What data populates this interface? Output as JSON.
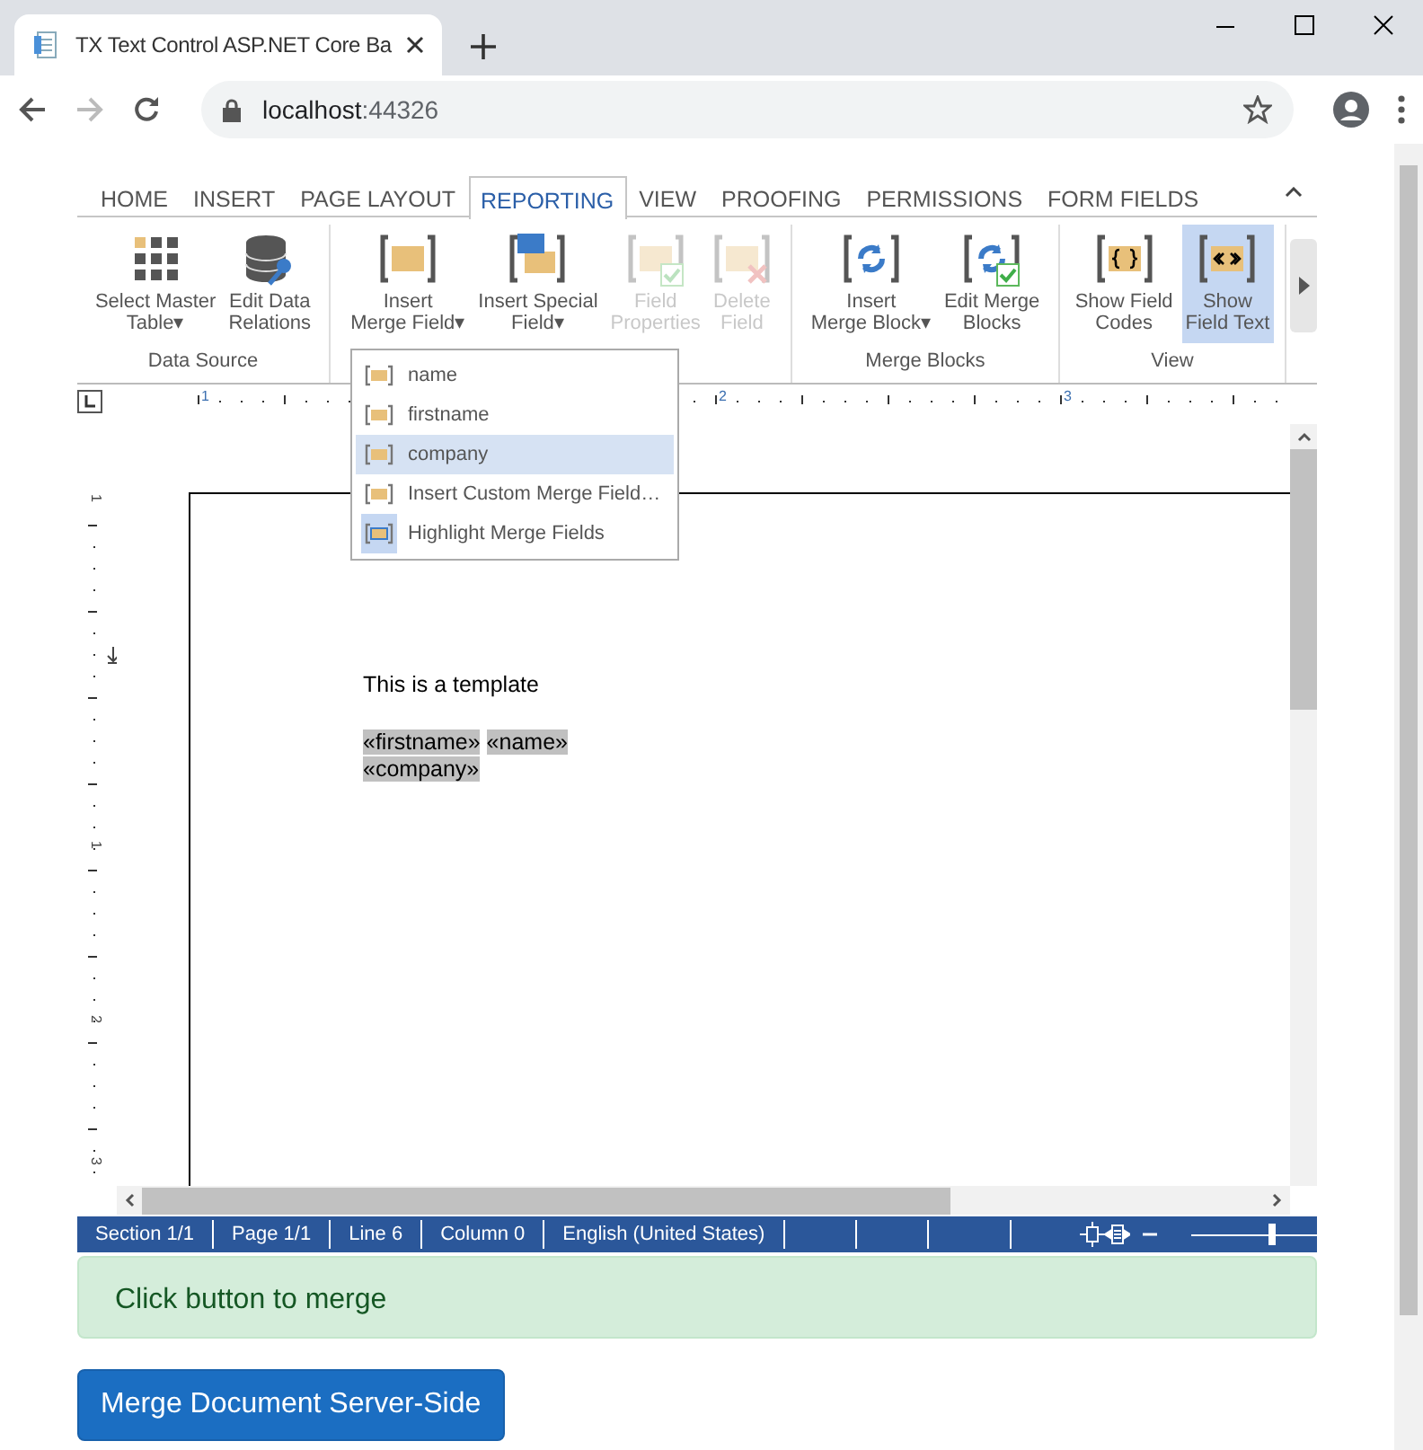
{
  "browser": {
    "tab_title": "TX Text Control ASP.NET Core Ba",
    "host": "localhost",
    "port": ":44326"
  },
  "ribbon": {
    "tabs": [
      {
        "label": "HOME",
        "selected": false
      },
      {
        "label": "INSERT",
        "selected": false
      },
      {
        "label": "PAGE LAYOUT",
        "selected": false
      },
      {
        "label": "REPORTING",
        "selected": true
      },
      {
        "label": "VIEW",
        "selected": false
      },
      {
        "label": "PROOFING",
        "selected": false
      },
      {
        "label": "PERMISSIONS",
        "selected": false
      },
      {
        "label": "FORM FIELDS",
        "selected": false
      }
    ],
    "groups": [
      {
        "label": "Data Source",
        "buttons": [
          {
            "kind": "grid",
            "lines": [
              "Select Master",
              "Table▾"
            ],
            "disabled": false,
            "selected": false
          },
          {
            "kind": "database",
            "lines": [
              "Edit Data",
              "Relations"
            ],
            "disabled": false,
            "selected": false
          }
        ]
      },
      {
        "buttons": [
          {
            "kind": "field",
            "lines": [
              "Insert",
              "Merge Field▾"
            ],
            "disabled": false,
            "selected": false
          },
          {
            "kind": "special",
            "lines": [
              "Insert Special",
              "Field▾"
            ],
            "disabled": false,
            "selected": false
          },
          {
            "kind": "field-check",
            "lines": [
              "Field",
              "Properties"
            ],
            "disabled": true,
            "selected": false
          },
          {
            "kind": "field-delete",
            "lines": [
              "Delete",
              "Field"
            ],
            "disabled": true,
            "selected": false
          }
        ]
      },
      {
        "label": "Merge Blocks",
        "buttons": [
          {
            "kind": "block",
            "lines": [
              "Insert",
              "Merge Block▾"
            ],
            "disabled": false,
            "selected": false
          },
          {
            "kind": "block-check",
            "lines": [
              "Edit Merge",
              "Blocks"
            ],
            "disabled": false,
            "selected": false
          }
        ]
      },
      {
        "label": "View",
        "buttons": [
          {
            "kind": "codes",
            "lines": [
              "Show Field",
              "Codes"
            ],
            "disabled": false,
            "selected": false
          },
          {
            "kind": "text",
            "lines": [
              "Show",
              "Field Text"
            ],
            "disabled": false,
            "selected": true
          }
        ]
      }
    ]
  },
  "merge_field_menu": [
    {
      "label": "name",
      "kind": "field",
      "selected": false
    },
    {
      "label": "firstname",
      "kind": "field",
      "selected": false
    },
    {
      "label": "company",
      "kind": "field",
      "selected": true
    },
    {
      "label": "Insert Custom Merge Field…",
      "kind": "field",
      "selected": false
    },
    {
      "label": "Highlight Merge Fields",
      "kind": "toggle",
      "selected": false,
      "checked": true
    }
  ],
  "rulers": {
    "horizontal": [
      "1",
      "2",
      "3"
    ],
    "vertical": [
      "1",
      "1",
      "2",
      "3"
    ]
  },
  "document": {
    "text": "This is a template",
    "field_lines": [
      [
        "«firstname»",
        "«name»"
      ],
      [
        "«company»"
      ]
    ]
  },
  "status_bar": {
    "items": [
      "Section 1/1",
      "Page 1/1",
      "Line 6",
      "Column 0",
      "English (United States)"
    ],
    "zoom": {
      "level": 0.64
    }
  },
  "alert": "Click button to merge",
  "merge_button": "Merge Document Server-Side"
}
